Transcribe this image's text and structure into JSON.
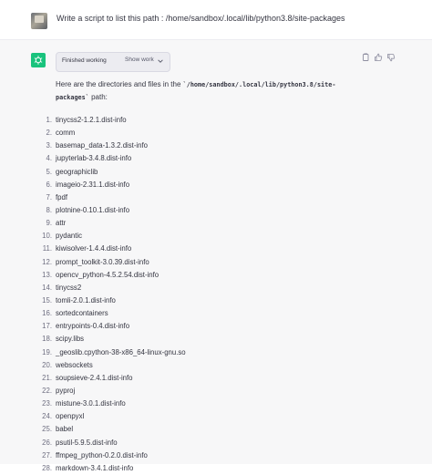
{
  "user": {
    "message": "Write a script to list this path : /home/sandbox/.local/lib/python3.8/site-packages"
  },
  "assistant": {
    "status_label": "Finished working",
    "show_work_label": "Show work",
    "intro_before": "Here are the directories and files in the ",
    "intro_path": "/home/sandbox/.local/lib/python3.8/site-packages",
    "intro_after": " path:",
    "items": [
      {
        "n": "1.",
        "text": "tinycss2-1.2.1.dist-info"
      },
      {
        "n": "2.",
        "text": "comm"
      },
      {
        "n": "3.",
        "text": "basemap_data-1.3.2.dist-info"
      },
      {
        "n": "4.",
        "text": "jupyterlab-3.4.8.dist-info"
      },
      {
        "n": "5.",
        "text": "geographiclib"
      },
      {
        "n": "6.",
        "text": "imageio-2.31.1.dist-info"
      },
      {
        "n": "7.",
        "text": "fpdf"
      },
      {
        "n": "8.",
        "text": "plotnine-0.10.1.dist-info"
      },
      {
        "n": "9.",
        "text": "attr"
      },
      {
        "n": "10.",
        "text": "pydantic"
      },
      {
        "n": "11.",
        "text": "kiwisolver-1.4.4.dist-info"
      },
      {
        "n": "12.",
        "text": "prompt_toolkit-3.0.39.dist-info"
      },
      {
        "n": "13.",
        "text": "opencv_python-4.5.2.54.dist-info"
      },
      {
        "n": "14.",
        "text": "tinycss2"
      },
      {
        "n": "15.",
        "text": "tomli-2.0.1.dist-info"
      },
      {
        "n": "16.",
        "text": "sortedcontainers"
      },
      {
        "n": "17.",
        "text": "entrypoints-0.4.dist-info"
      },
      {
        "n": "18.",
        "text": "scipy.libs"
      },
      {
        "n": "19.",
        "text": "_geoslib.cpython-38-x86_64-linux-gnu.so"
      },
      {
        "n": "20.",
        "text": "websockets"
      },
      {
        "n": "21.",
        "text": "soupsieve-2.4.1.dist-info"
      },
      {
        "n": "22.",
        "text": "pyproj"
      },
      {
        "n": "23.",
        "text": "mistune-3.0.1.dist-info"
      },
      {
        "n": "24.",
        "text": "openpyxl"
      },
      {
        "n": "25.",
        "text": "babel"
      },
      {
        "n": "26.",
        "text": "psutil-5.9.5.dist-info"
      },
      {
        "n": "27.",
        "text": "ffmpeg_python-0.2.0.dist-info"
      },
      {
        "n": "28.",
        "text": "markdown-3.4.1.dist-info"
      }
    ]
  },
  "icons": {
    "copy": "copy-icon",
    "thumbs_up": "thumbs-up-icon",
    "thumbs_down": "thumbs-down-icon",
    "chevron": "chevron-down-icon",
    "assistant_logo": "openai-logo-icon"
  },
  "colors": {
    "accent": "#19c37d",
    "assistant_bg": "#f7f7f8",
    "text": "#343541"
  }
}
